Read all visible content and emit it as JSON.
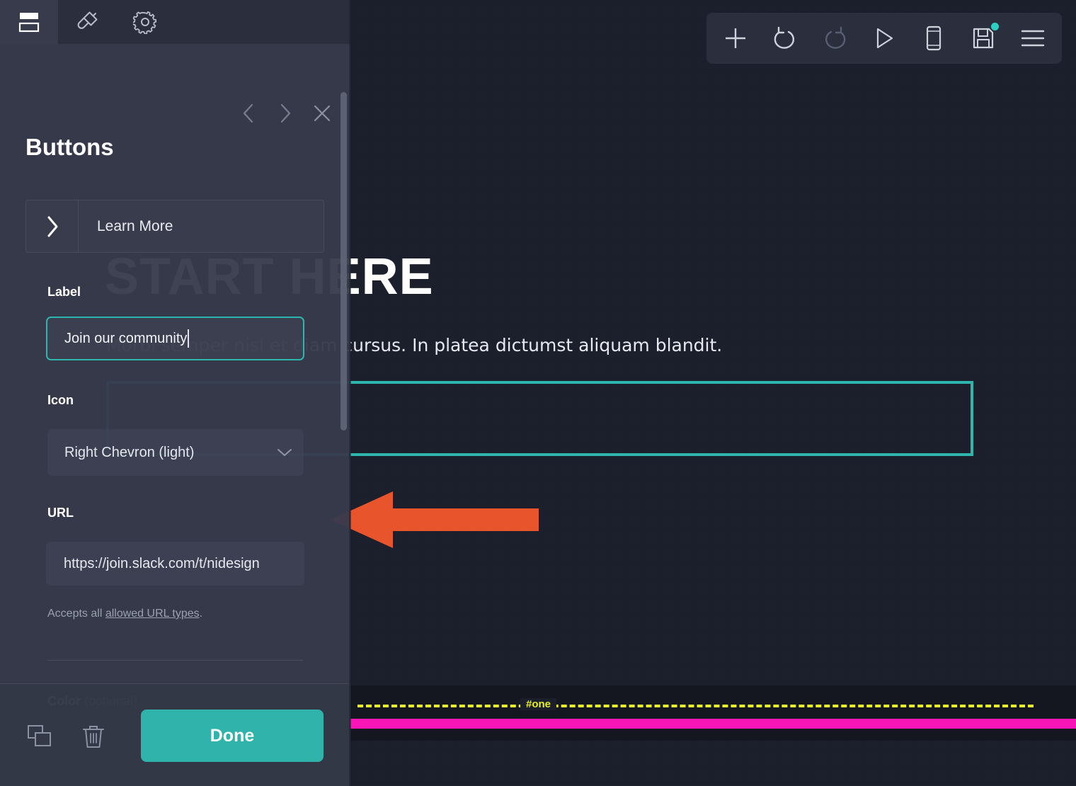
{
  "app": {
    "accent_teal": "#2fb3ab",
    "panel_bg": "#373b4b",
    "canvas_bg": "#1b1f2b"
  },
  "tabs": [
    {
      "name": "sections",
      "icon": "layout-sections-icon",
      "active": true
    },
    {
      "name": "design",
      "icon": "paintbrush-icon",
      "active": false
    },
    {
      "name": "settings",
      "icon": "gear-icon",
      "active": false
    }
  ],
  "panel": {
    "title": "Buttons",
    "nav": {
      "back_icon": "chevron-left-icon",
      "forward_icon": "chevron-right-icon",
      "close_icon": "close-icon"
    },
    "item": {
      "icon": "right-chevron-icon",
      "label": "Learn More"
    },
    "fields": {
      "label": {
        "title": "Label",
        "value": "Join our community",
        "placeholder": "Label",
        "focused": true
      },
      "icon": {
        "title": "Icon",
        "value": "Right Chevron (light)",
        "chevron_icon": "chevron-down-icon"
      },
      "url": {
        "title": "URL",
        "value": "https://join.slack.com/t/nidesign",
        "placeholder": "https://",
        "helper_prefix": "Accepts all ",
        "helper_link": "allowed URL types",
        "helper_suffix": "."
      },
      "color": {
        "title": "Color",
        "optional": "(optional)"
      }
    },
    "footer": {
      "duplicate_icon": "duplicate-icon",
      "delete_icon": "trash-icon",
      "done_label": "Done"
    }
  },
  "toolbar": {
    "buttons": [
      {
        "name": "add",
        "icon": "plus-icon",
        "disabled": false,
        "badge": false
      },
      {
        "name": "undo",
        "icon": "undo-icon",
        "disabled": false,
        "badge": false
      },
      {
        "name": "redo",
        "icon": "redo-icon",
        "disabled": true,
        "badge": false
      },
      {
        "name": "preview",
        "icon": "play-icon",
        "disabled": false,
        "badge": false
      },
      {
        "name": "device",
        "icon": "mobile-device-icon",
        "disabled": false,
        "badge": false
      },
      {
        "name": "save",
        "icon": "save-icon",
        "disabled": false,
        "badge": true
      },
      {
        "name": "menu",
        "icon": "hamburger-menu-icon",
        "disabled": false,
        "badge": false
      }
    ]
  },
  "canvas": {
    "heading": "START HERE",
    "paragraph": "Morbi semper nisl et diam cursus. In platea dictumst aliquam blandit.",
    "guide_label": "#one",
    "guide_color": "#e8ef22",
    "bar_color": "#f916b6",
    "selection_color": "#2eb6ae"
  },
  "annotation": {
    "arrow": "left-pointing-arrow",
    "color": "#e8552c"
  }
}
